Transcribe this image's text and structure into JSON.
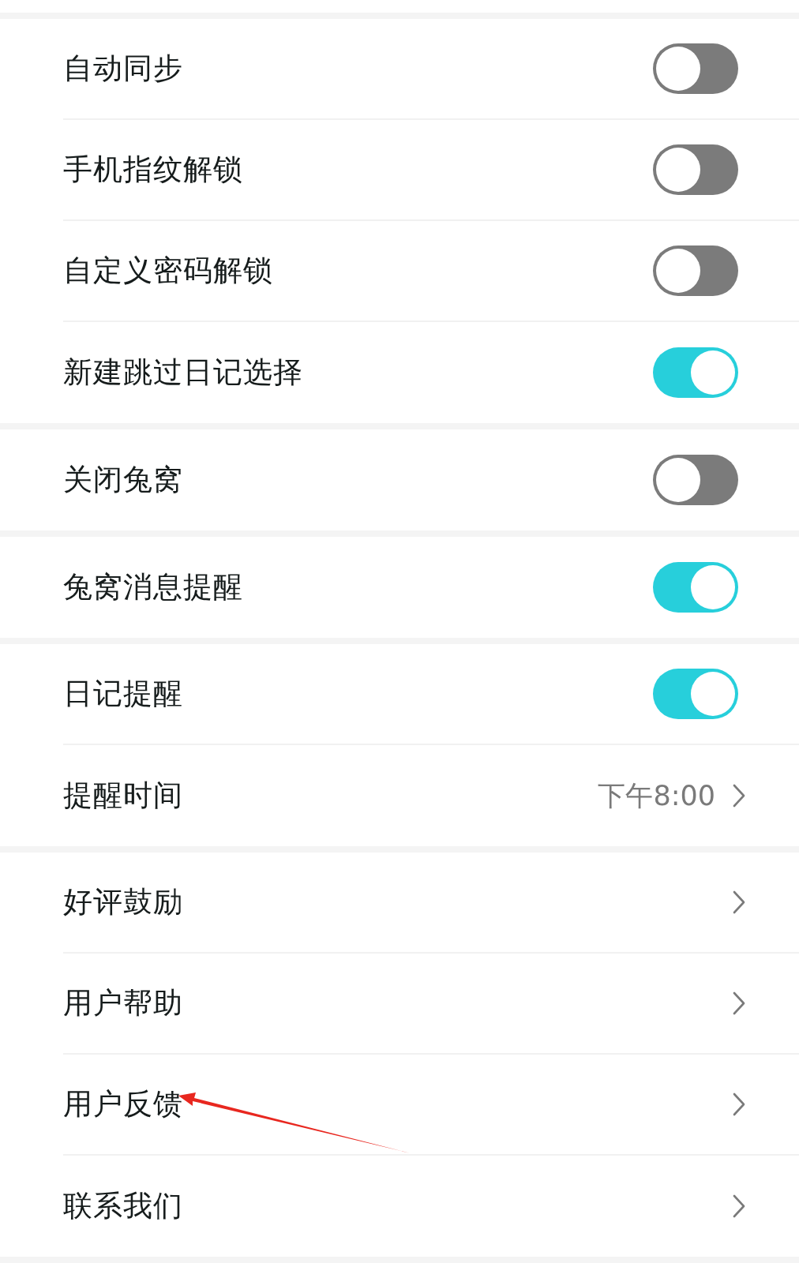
{
  "groups": [
    {
      "items": [
        {
          "kind": "toggle",
          "label": "自动同步",
          "on": false
        },
        {
          "kind": "toggle",
          "label": "手机指纹解锁",
          "on": false
        },
        {
          "kind": "toggle",
          "label": "自定义密码解锁",
          "on": false
        },
        {
          "kind": "toggle",
          "label": "新建跳过日记选择",
          "on": true
        }
      ]
    },
    {
      "items": [
        {
          "kind": "toggle",
          "label": "关闭兔窝",
          "on": false
        }
      ]
    },
    {
      "items": [
        {
          "kind": "toggle",
          "label": "兔窝消息提醒",
          "on": true
        }
      ]
    },
    {
      "items": [
        {
          "kind": "toggle",
          "label": "日记提醒",
          "on": true
        },
        {
          "kind": "link",
          "label": "提醒时间",
          "value": "下午8:00"
        }
      ]
    },
    {
      "items": [
        {
          "kind": "link",
          "label": "好评鼓励"
        },
        {
          "kind": "link",
          "label": "用户帮助"
        },
        {
          "kind": "link",
          "label": "用户反馈"
        },
        {
          "kind": "link",
          "label": "联系我们"
        }
      ]
    }
  ]
}
